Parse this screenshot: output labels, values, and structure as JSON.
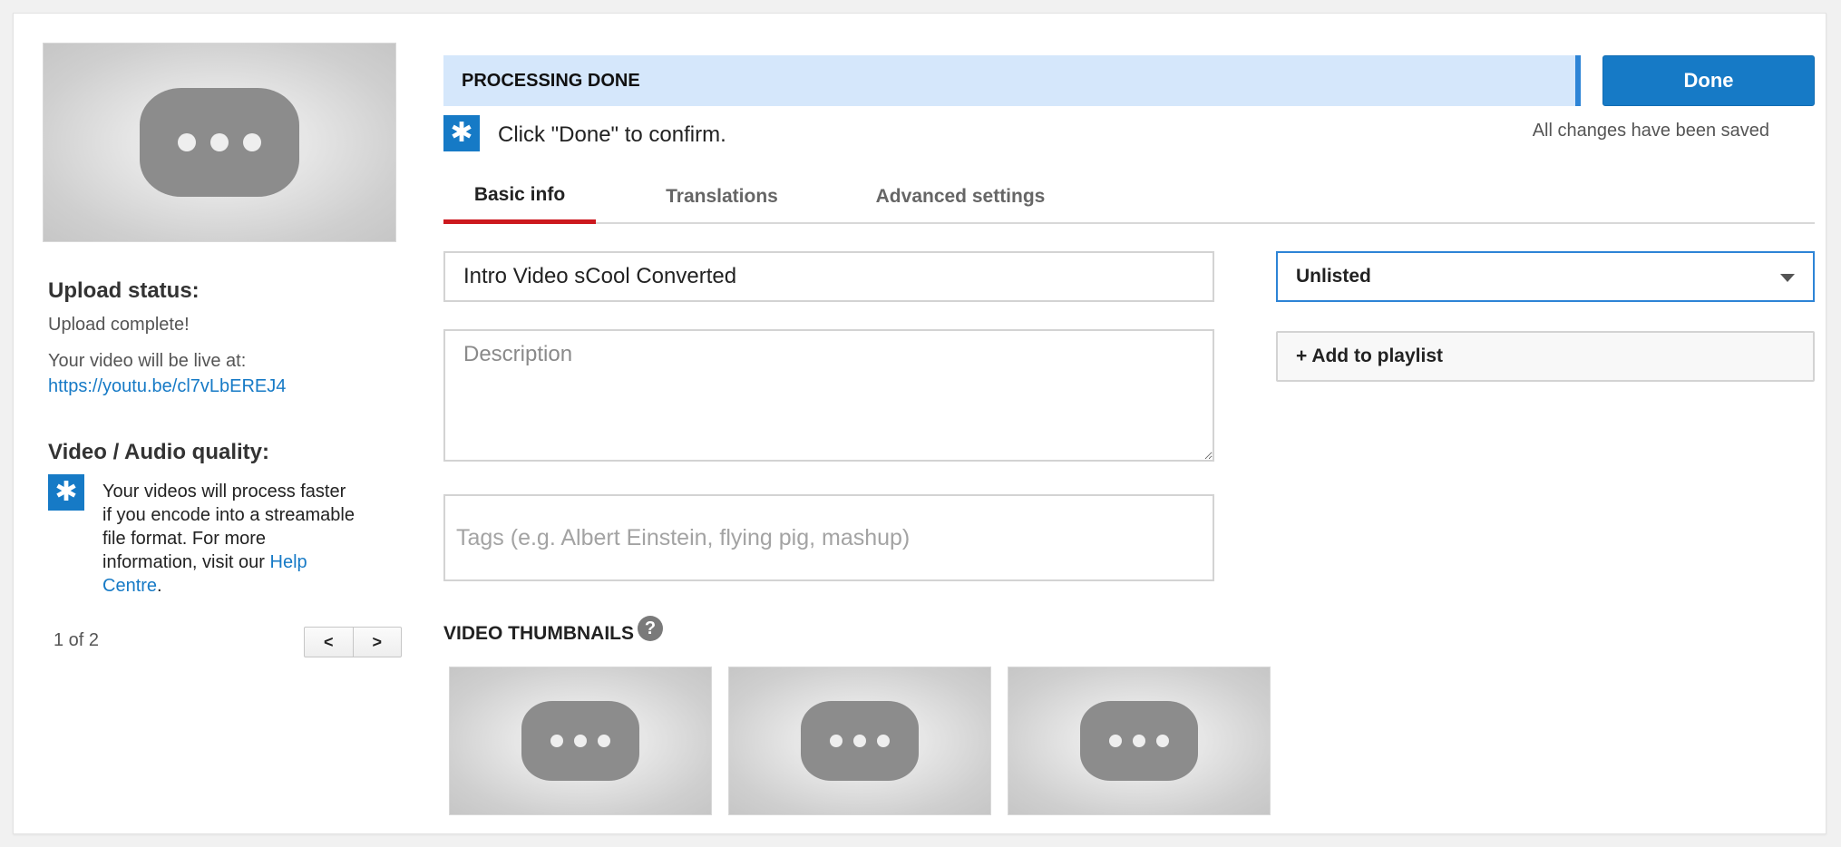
{
  "left_panel": {
    "upload_status_heading": "Upload status:",
    "upload_status_text": "Upload complete!",
    "live_at_text": "Your video will be live at:",
    "video_url": "https://youtu.be/cl7vLbEREJ4",
    "quality_heading": "Video / Audio quality:",
    "quality_message": "Your videos will process faster if you encode into a streamable file format. For more information, visit our",
    "help_link": "Help Centre",
    "help_suffix": ".",
    "pager_text": "1 of 2",
    "prev_label": "<",
    "next_label": ">"
  },
  "header": {
    "processing_text": "PROCESSING DONE",
    "done_label": "Done",
    "confirm_text": "Click \"Done\" to confirm.",
    "saved_text": "All changes have been saved"
  },
  "tabs": [
    {
      "label": "Basic info",
      "active": true
    },
    {
      "label": "Translations",
      "active": false
    },
    {
      "label": "Advanced settings",
      "active": false
    }
  ],
  "form": {
    "title_value": "Intro Video sCool Converted",
    "description_placeholder": "Description",
    "tags_placeholder": "Tags (e.g. Albert Einstein, flying pig, mashup)",
    "privacy_value": "Unlisted",
    "add_playlist_label": "+ Add to playlist"
  },
  "thumbnails": {
    "heading": "VIDEO THUMBNAILS",
    "help_glyph": "?"
  },
  "icons": {
    "info_star": "✱",
    "placeholder": "video-placeholder-icon"
  },
  "colors": {
    "accent_blue": "#167ac6",
    "processing_bg": "#d5e7fb",
    "active_tab_red": "#cc181e"
  }
}
